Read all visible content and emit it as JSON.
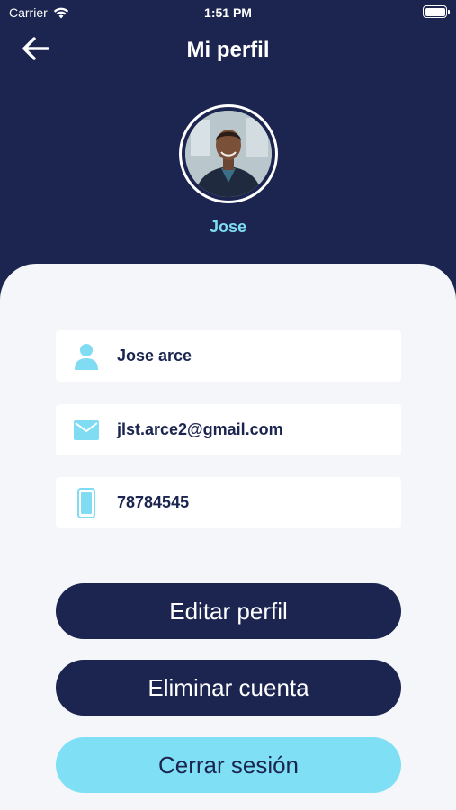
{
  "status_bar": {
    "carrier": "Carrier",
    "time": "1:51 PM"
  },
  "header": {
    "title": "Mi perfil",
    "back_icon": "arrow-left-icon"
  },
  "profile": {
    "display_name": "Jose"
  },
  "fields": {
    "name": {
      "icon": "person-icon",
      "value": "Jose arce"
    },
    "email": {
      "icon": "mail-icon",
      "value": "jlst.arce2@gmail.com"
    },
    "phone": {
      "icon": "phone-icon",
      "value": "78784545"
    }
  },
  "actions": {
    "edit_label": "Editar perfil",
    "delete_label": "Eliminar cuenta",
    "logout_label": "Cerrar sesión"
  },
  "colors": {
    "primary": "#1b2550",
    "accent": "#7fdcf2",
    "background": "#f4f6f9"
  }
}
